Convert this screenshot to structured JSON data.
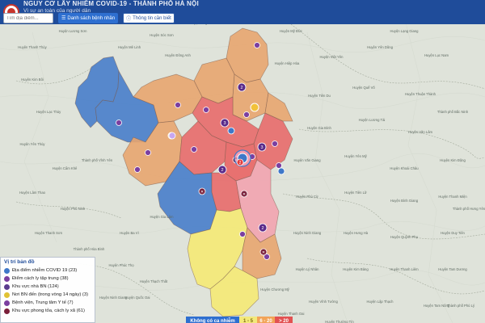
{
  "header": {
    "title": "NGUY CƠ LÂY NHIỄM COVID-19 - THÀNH PHỐ HÀ NỘI",
    "subtitle": "Vì sự an toàn của người dân"
  },
  "toolbar": {
    "search_placeholder": "Tìm địa điểm...",
    "patients_button": "Danh sách bệnh nhân",
    "info_button": "Thông tin cần biết"
  },
  "legend": {
    "title": "Vị trí bản đồ",
    "items": [
      {
        "label": "Địa điểm nhiễm COVID 19 (23)",
        "color": "#3f78c9",
        "icon": "virus-icon"
      },
      {
        "label": "Điểm cách ly tập trung (38)",
        "color": "#7b3fa0",
        "icon": "quarantine-icon"
      },
      {
        "label": "Khu vực nhà BN (124)",
        "color": "#5a3c8e",
        "icon": "house-icon"
      },
      {
        "label": "Nơi BN đến (trong vòng 14 ngày) (3)",
        "color": "#e0c234",
        "icon": "location-icon"
      },
      {
        "label": "Bệnh viện, Trung tâm Y tế (7)",
        "color": "#7b3fa0",
        "icon": "hospital-icon"
      },
      {
        "label": "Khu vực phong tỏa, cách ly xã (61)",
        "color": "#7a1f3a",
        "icon": "lockdown-icon"
      }
    ]
  },
  "scale": {
    "none": "Không có ca nhiễm",
    "low": "1 - 5",
    "mid": "6 - 20",
    "high": "> 20"
  },
  "map": {
    "colors": {
      "blue": "#3f78c9",
      "orange": "#e8a56f",
      "red": "#e86a6a",
      "pink": "#f0a6b2",
      "yellow": "#f3e97a",
      "land": "#dfe3da"
    },
    "marker_numbers": [
      "2",
      "3",
      "2",
      "2",
      "3",
      "2"
    ],
    "places": [
      "Huyện Tân Yên",
      "Huyện Lạng Giang",
      "Huyện Việt Yên",
      "Huyện Yên Dũng",
      "Huyện Lục Nam",
      "Huyện Tiên Du",
      "Huyện Quế Võ",
      "Huyện Thuận Thành",
      "Huyện Gia Bình",
      "Huyện Lương Tài",
      "Huyện Văn Lâm",
      "Huyện Văn Giang",
      "Huyện Yên Mỹ",
      "Huyện Khoái Châu",
      "Huyện Kim Động",
      "Huyện Phù Cừ",
      "Huyện Tiên Lữ",
      "Huyện Bình Giang",
      "Huyện Thanh Miện",
      "Huyện Ninh Giang",
      "Huyện Hưng Hà",
      "Huyện Quỳnh Phụ",
      "Huyện Duy Tiên",
      "Huyện Lý Nhân",
      "Huyện Kim Bảng",
      "Huyện Thanh Liêm",
      "Huyện Tam Dương",
      "Huyện Vĩnh Tường",
      "Huyện Lập Thạch",
      "Huyện Tam Nông",
      "Huyện Thanh Thủy",
      "Huyện Lương Sơn",
      "Huyện Kim Bôi",
      "Huyện Lạc Thủy",
      "Huyện Yên Thủy",
      "Huyện Cẩm Khê",
      "Huyện Lâm Thao",
      "Huyện Phù Ninh",
      "Huyện Thanh Sơn",
      "Huyện Sóc Sơn",
      "Huyện Đông Anh",
      "Huyện Mê Linh",
      "Huyện Gia Lâm",
      "Huyện Ba Vì",
      "Huyện Phúc Thọ",
      "Huyện Thạch Thất",
      "Huyện Quốc Oai",
      "Huyện Chương Mỹ",
      "Huyện Thanh Oai",
      "Huyện Thường Tín",
      "Huyện Phú Xuyên",
      "Huyện Ứng Hòa",
      "Huyện Mỹ Đức",
      "Huyện Hiệp Hòa",
      "Thành phố Bắc Ninh",
      "Thành phố Hưng Yên",
      "Thành phố Phủ Lý",
      "Thành phố Vĩnh Yên",
      "Thành phố Hòa Bình",
      "Huyện Ninh Giang"
    ]
  }
}
